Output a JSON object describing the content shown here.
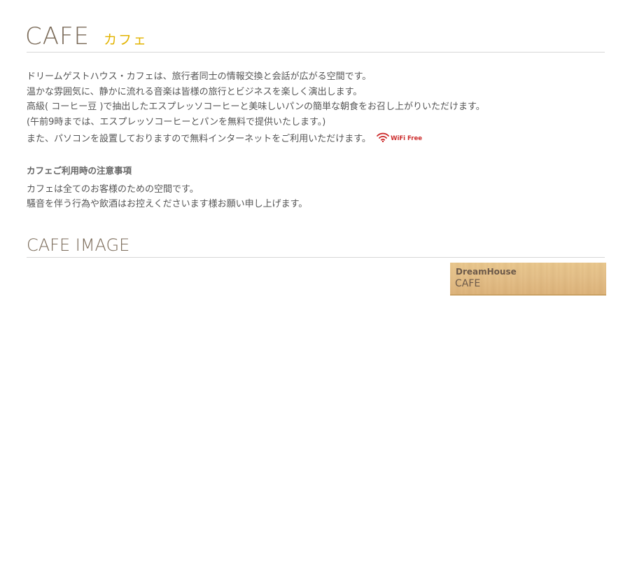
{
  "cafe": {
    "heading": "CAFE",
    "heading_sub": "カフェ",
    "intro_lines": [
      "ドリームゲストハウス・カフェは、旅行者同士の情報交換と会話が広がる空間です。",
      "温かな雰囲気に、静かに流れる音楽は皆様の旅行とビジネスを楽しく演出します。",
      "高級( コーヒー豆 )で抽出したエスプレッソコーヒーと美味しいパンの簡単な朝食をお召し上がりいただけます。",
      "(午前9時までは、エスプレッソコーヒーとパンを無料で提供いたします。)",
      "また、パソコンを設置しておりますので無料インターネットをご利用いただけます。"
    ],
    "wifi": {
      "icon": "wifi-icon",
      "label": "WiFi Free",
      "color": "#cc2b2b"
    },
    "notice_title": "カフェご利用時の注意事項",
    "notice_lines": [
      "カフェは全てのお客様のための空間です。",
      "騒音を伴う行為や飲酒はお控えくださいます様お願い申し上げます。"
    ]
  },
  "cafe_image": {
    "heading": "CAFE IMAGE",
    "card_title": "DreamHouse",
    "card_sub": "CAFE"
  },
  "colors": {
    "heading_brown": "#7a6a58",
    "heading_accent": "#e2b300",
    "body_text": "#555555",
    "divider": "#d6d6d6",
    "wood": "#e4c08a"
  }
}
